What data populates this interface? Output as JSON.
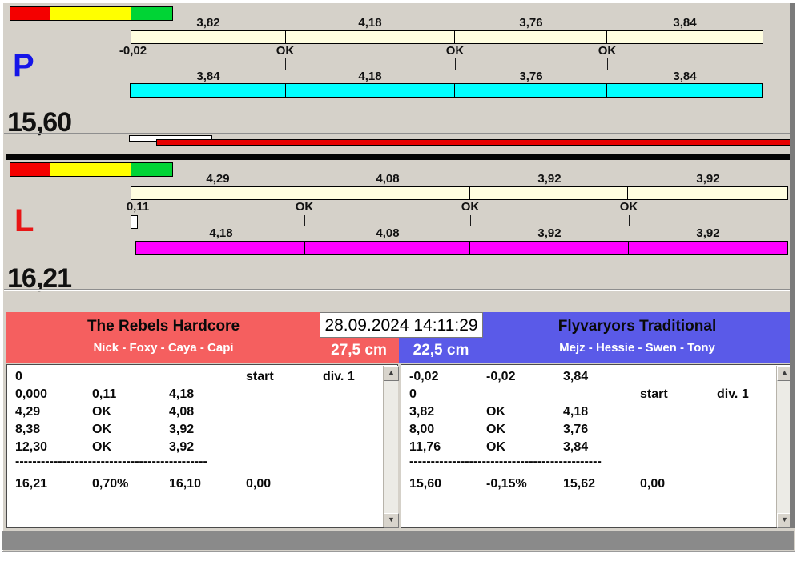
{
  "window": {
    "background": "#D5D1C9",
    "status_bar_color": "#8A8A8A",
    "separator_color": "#000000"
  },
  "traffic_lights": {
    "colors": [
      "#F40000",
      "#FFFF00",
      "#FFFF00",
      "#00D435"
    ]
  },
  "p_panel": {
    "label": "P",
    "letter_color": "#1515E8",
    "total": "15,60",
    "start_offset": "-0,02",
    "top_bar": {
      "color": "#FFFEE0",
      "values": [
        "3,82",
        "4,18",
        "3,76",
        "3,84"
      ]
    },
    "ok_labels": [
      "OK",
      "OK",
      "OK"
    ],
    "bottom_bar": {
      "color": "#00FFFF",
      "values": [
        "3,84",
        "4,18",
        "3,76",
        "3,84"
      ]
    },
    "diff_bars": {
      "white": "#FFFFFF",
      "red": "#E60000"
    }
  },
  "l_panel": {
    "label": "L",
    "letter_color": "#E81515",
    "total": "16,21",
    "start_offset": "0,11",
    "top_bar": {
      "color": "#FFFEE0",
      "values": [
        "4,29",
        "4,08",
        "3,92",
        "3,92"
      ]
    },
    "ok_labels": [
      "OK",
      "OK",
      "OK"
    ],
    "bottom_bar": {
      "color": "#FF00FF",
      "values": [
        "4,18",
        "4,08",
        "3,92",
        "3,92"
      ]
    }
  },
  "scoreboard": {
    "datetime": "28.09.2024 14:11:29",
    "left_team": {
      "name": "The Rebels Hardcore",
      "crew": "Nick - Foxy - Caya - Capi",
      "color": "#F55F5F",
      "measure": "27,5 cm"
    },
    "right_team": {
      "name": "Flyvaryors Traditional",
      "crew": "Mejz - Hessie - Swen - Tony",
      "color": "#5A5AE8",
      "measure": "22,5 cm"
    },
    "left_table": {
      "rows": [
        [
          "0",
          "",
          "",
          "start",
          "div. 1"
        ],
        [
          "0,000",
          "0,11",
          "4,18",
          "",
          ""
        ],
        [
          "4,29",
          "OK",
          "4,08",
          "",
          ""
        ],
        [
          "8,38",
          "OK",
          "3,92",
          "",
          ""
        ],
        [
          "12,30",
          "OK",
          "3,92",
          "",
          ""
        ]
      ],
      "divider": "---------------------------------------------",
      "totals": [
        "16,21",
        "0,70%",
        "16,10",
        "0,00"
      ]
    },
    "right_table": {
      "rows": [
        [
          "-0,02",
          "-0,02",
          "3,84",
          "",
          ""
        ],
        [
          "0",
          "",
          "",
          "start",
          "div. 1"
        ],
        [
          "3,82",
          "OK",
          "4,18",
          "",
          ""
        ],
        [
          "8,00",
          "OK",
          "3,76",
          "",
          ""
        ],
        [
          "11,76",
          "OK",
          "3,84",
          "",
          ""
        ]
      ],
      "divider": "---------------------------------------------",
      "totals": [
        "15,60",
        "-0,15%",
        "15,62",
        "0,00"
      ]
    }
  }
}
